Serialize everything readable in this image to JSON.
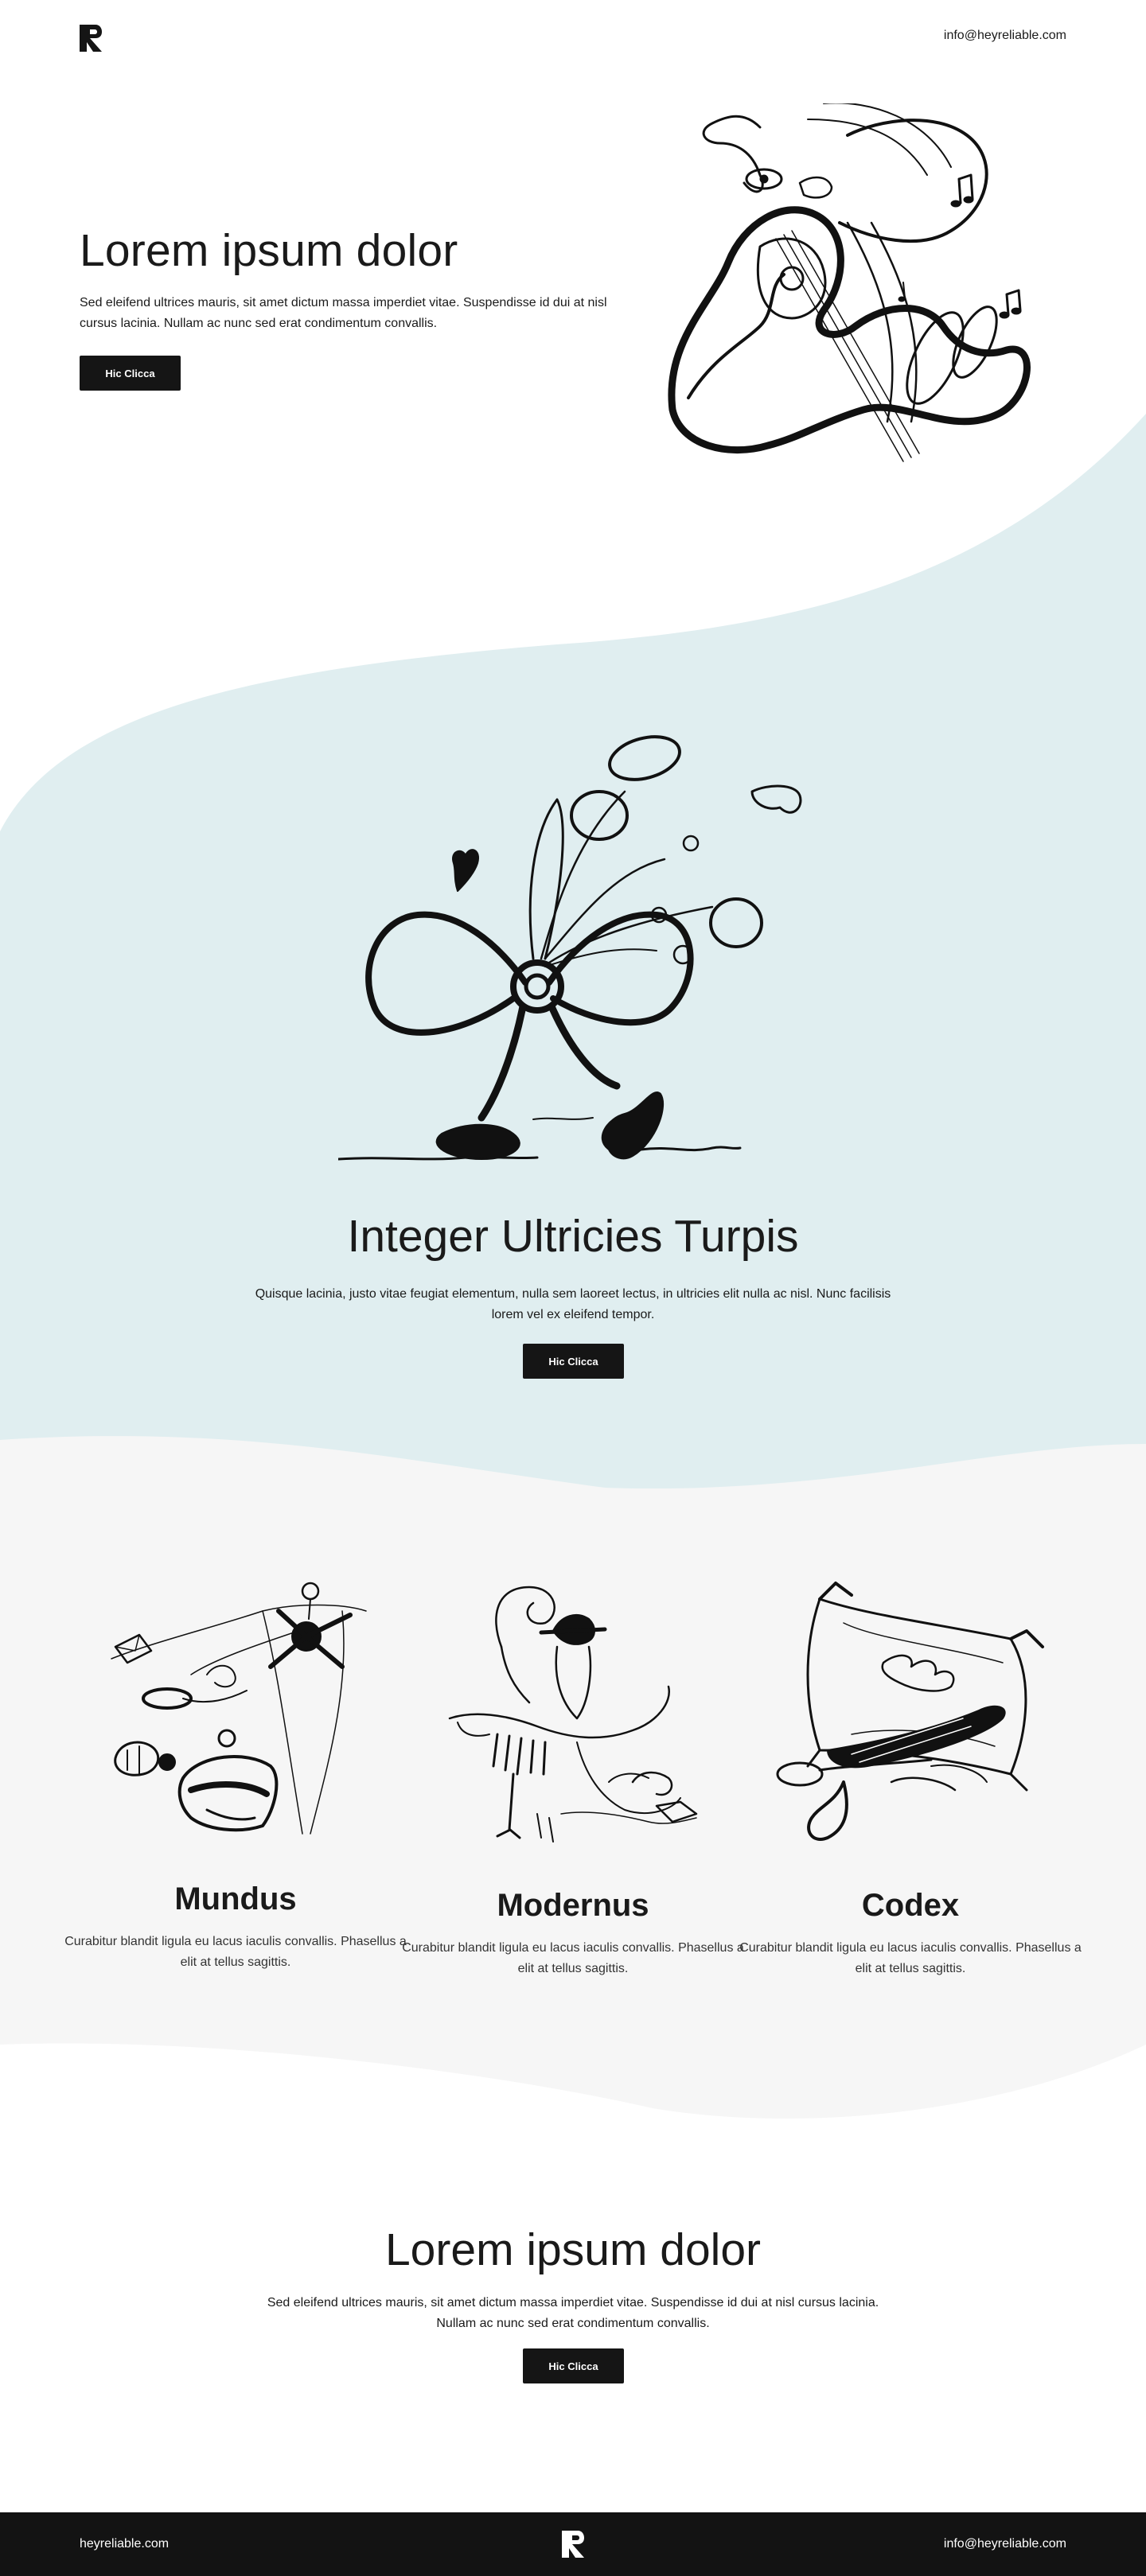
{
  "header": {
    "email": "info@heyreliable.com",
    "logo_icon": "reliable-logo-icon"
  },
  "hero": {
    "title": "Lorem ipsum dolor",
    "text": "Sed eleifend ultrices mauris, sit amet dictum massa imperdiet vitae. Suspendisse id dui at nisl cursus lacinia. Nullam ac nunc sed erat condimentum convallis.",
    "button_label": "Hic Clicca",
    "illustration": "guitar-music-doodle-illustration"
  },
  "feature": {
    "title": "Integer Ultricies Turpis",
    "text": "Quisque lacinia, justo vitae feugiat elementum, nulla sem laoreet lectus, in ultricies elit nulla ac nisl. Nunc facilisis lorem vel ex eleifend tempor.",
    "button_label": "Hic Clicca",
    "illustration": "walking-bow-doodle-illustration"
  },
  "columns": [
    {
      "title": "Mundus",
      "text": "Curabitur blandit ligula eu lacus iaculis convallis. Phasellus a elit at tellus sagittis.",
      "illustration": "world-objects-doodle-illustration"
    },
    {
      "title": "Modernus",
      "text": "Curabitur blandit ligula eu lacus iaculis convallis. Phasellus a elit at tellus sagittis.",
      "illustration": "bird-hat-doodle-illustration"
    },
    {
      "title": "Codex",
      "text": "Curabitur blandit ligula eu lacus iaculis convallis. Phasellus a elit at tellus sagittis.",
      "illustration": "pillow-spoon-doodle-illustration"
    }
  ],
  "cta": {
    "title": "Lorem ipsum dolor",
    "text": "Sed eleifend ultrices mauris, sit amet dictum massa imperdiet vitae. Suspendisse id dui at nisl cursus lacinia. Nullam ac nunc sed erat condimentum convallis.",
    "button_label": "Hic Clicca"
  },
  "footer": {
    "site": "heyreliable.com",
    "email": "info@heyreliable.com"
  },
  "colors": {
    "accent_blue": "#e0eef0",
    "light_gray": "#f6f6f6",
    "dark": "#151515",
    "footer": "#131313"
  }
}
